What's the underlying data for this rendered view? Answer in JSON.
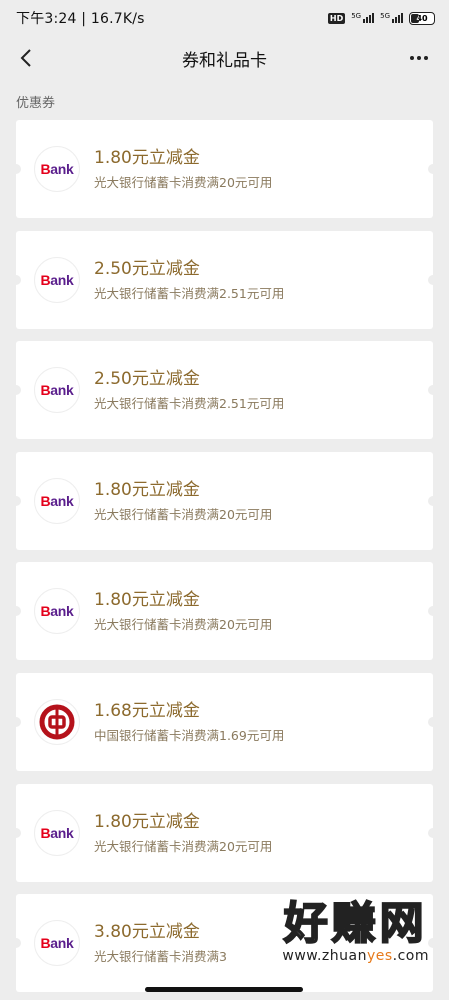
{
  "status_bar": {
    "time_speed": "下午3:24 | 16.7K/s",
    "hd_label": "HD",
    "network1": "5G",
    "network2": "5G",
    "battery": "40",
    "battery_level": 0.4
  },
  "nav": {
    "title": "券和礼品卡",
    "back_icon": "chevron-left-icon",
    "more_icon": "more-dots-icon"
  },
  "section": {
    "title": "优惠券"
  },
  "coupons": [
    {
      "logo": "Bank",
      "logo_type": "ceb",
      "amount": "1.80元立减金",
      "desc": "光大银行储蓄卡消费满20元可用"
    },
    {
      "logo": "Bank",
      "logo_type": "ceb",
      "amount": "2.50元立减金",
      "desc": "光大银行储蓄卡消费满2.51元可用"
    },
    {
      "logo": "Bank",
      "logo_type": "ceb",
      "amount": "2.50元立减金",
      "desc": "光大银行储蓄卡消费满2.51元可用"
    },
    {
      "logo": "Bank",
      "logo_type": "ceb",
      "amount": "1.80元立减金",
      "desc": "光大银行储蓄卡消费满20元可用"
    },
    {
      "logo": "Bank",
      "logo_type": "ceb",
      "amount": "1.80元立减金",
      "desc": "光大银行储蓄卡消费满20元可用"
    },
    {
      "logo": "",
      "logo_type": "boc",
      "amount": "1.68元立减金",
      "desc": "中国银行储蓄卡消费满1.69元可用"
    },
    {
      "logo": "Bank",
      "logo_type": "ceb",
      "amount": "1.80元立减金",
      "desc": "光大银行储蓄卡消费满20元可用"
    },
    {
      "logo": "Bank",
      "logo_type": "ceb",
      "amount": "3.80元立减金",
      "desc": "光大银行储蓄卡消费满3"
    }
  ],
  "watermark": {
    "big": "好赚网",
    "small_pre": "www.zhuan",
    "small_yes": "yes",
    "small_post": ".com"
  },
  "colors": {
    "background": "#ededed",
    "amount": "#8c6a2e",
    "ceb_red": "#e4001b",
    "ceb_purple": "#5a1e8c",
    "boc_red": "#b5121b"
  }
}
